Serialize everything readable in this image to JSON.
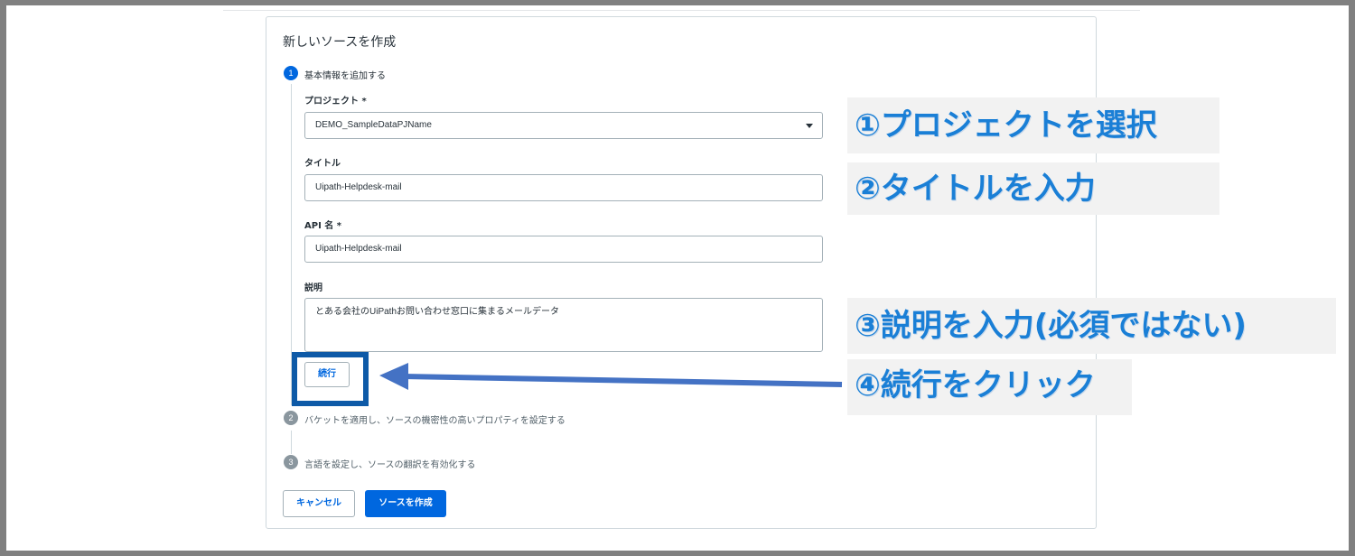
{
  "form": {
    "title": "新しいソースを作成",
    "steps": [
      {
        "number": "1",
        "label": "基本情報を追加する"
      },
      {
        "number": "2",
        "label": "バケットを適用し、ソースの機密性の高いプロパティを設定する"
      },
      {
        "number": "3",
        "label": "言語を設定し、ソースの翻訳を有効化する"
      }
    ],
    "project": {
      "label": "プロジェクト *",
      "value": "DEMO_SampleDataPJName"
    },
    "title_field": {
      "label": "タイトル",
      "value": "Uipath-Helpdesk-mail"
    },
    "api_name": {
      "label": "API 名 *",
      "value": "Uipath-Helpdesk-mail"
    },
    "description": {
      "label": "説明",
      "value": "とある会社のUiPathお問い合わせ窓口に集まるメールデータ"
    },
    "continue_label": "続行",
    "cancel_label": "キャンセル",
    "create_label": "ソースを作成"
  },
  "annotations": {
    "a1": "①プロジェクトを選択",
    "a2": "②タイトルを入力",
    "a3": "③説明を入力(必須ではない)",
    "a4": "④続行をクリック"
  },
  "colors": {
    "primary": "#0067df",
    "annotation_text": "#1a7fd6",
    "highlight": "#0e5aa7",
    "arrow": "#4472c4"
  }
}
